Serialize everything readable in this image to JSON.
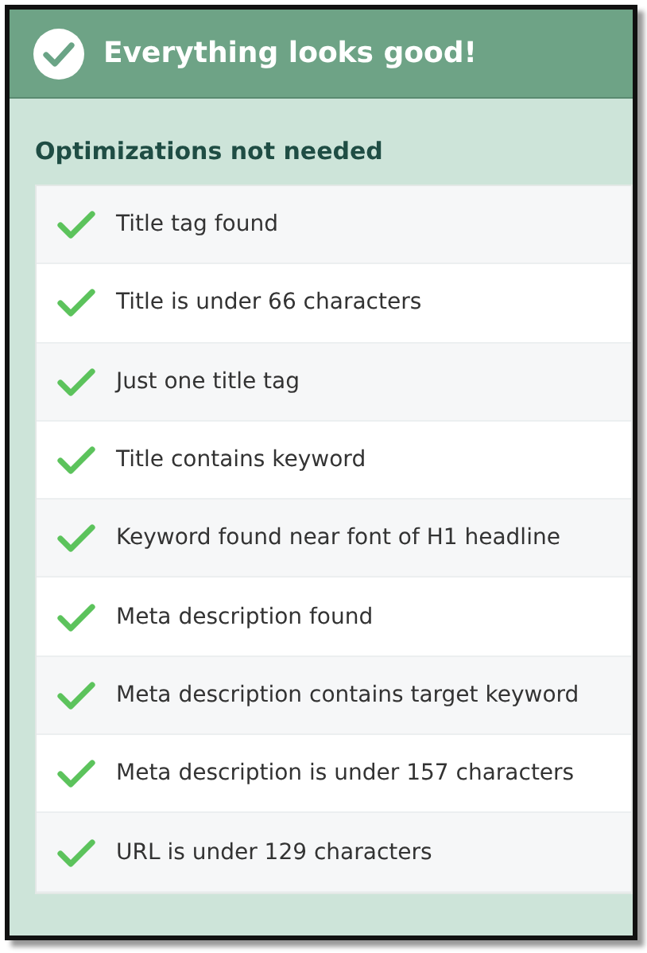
{
  "header": {
    "title": "Everything looks good!"
  },
  "section": {
    "title": "Optimizations not needed"
  },
  "items": [
    {
      "label": "Title tag found",
      "passed": true
    },
    {
      "label": "Title is under 66 characters",
      "passed": true
    },
    {
      "label": "Just one title tag",
      "passed": true
    },
    {
      "label": "Title contains keyword",
      "passed": true
    },
    {
      "label": "Keyword found near font of H1 headline",
      "passed": true
    },
    {
      "label": "Meta description found",
      "passed": true
    },
    {
      "label": "Meta description contains target keyword",
      "passed": true
    },
    {
      "label": "Meta description is under 157 characters",
      "passed": true
    },
    {
      "label": "URL is under 129 characters",
      "passed": true
    }
  ]
}
